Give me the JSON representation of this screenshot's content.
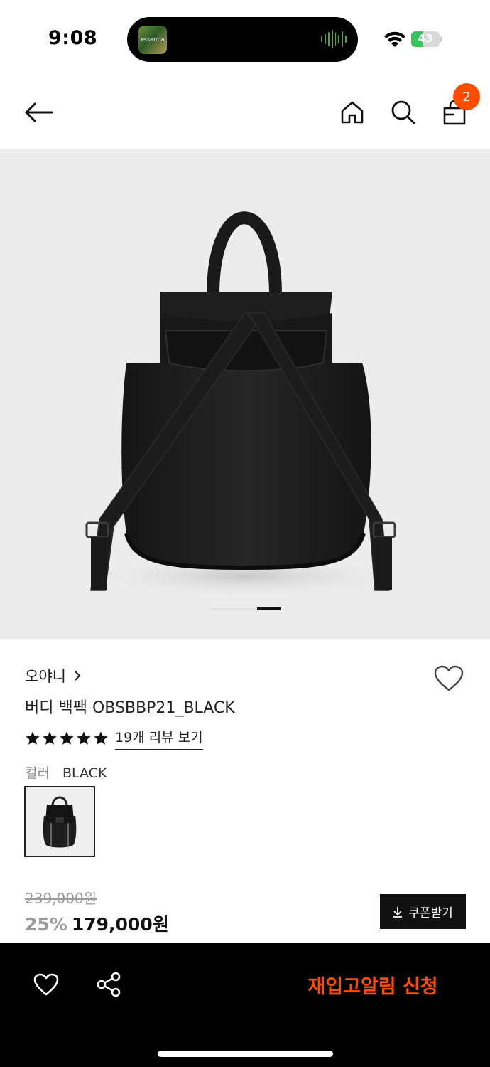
{
  "status_bar": {
    "time": "9:08",
    "now_playing_art_text": "essential;",
    "battery_level": 43,
    "battery_text": "43"
  },
  "header": {
    "cart_count": "2",
    "icons": [
      "back-arrow-icon",
      "home-icon",
      "search-icon",
      "shopping-bag-icon"
    ]
  },
  "gallery": {
    "current_slide_fraction": 1.0
  },
  "product": {
    "brand": "오야니",
    "name": "버디 백팩 OBSBBP21_BLACK",
    "rating_stars": 5,
    "review_link": "19개 리뷰 보기",
    "color_label": "컬러",
    "color_value": "BLACK"
  },
  "price": {
    "original": "239,000원",
    "discount": "25%",
    "sale": "179,000원",
    "coupon_label": "쿠폰받기"
  },
  "bottom_bar": {
    "restock_label": "재입고알림 신청",
    "accent_color": "#ff4d00"
  }
}
